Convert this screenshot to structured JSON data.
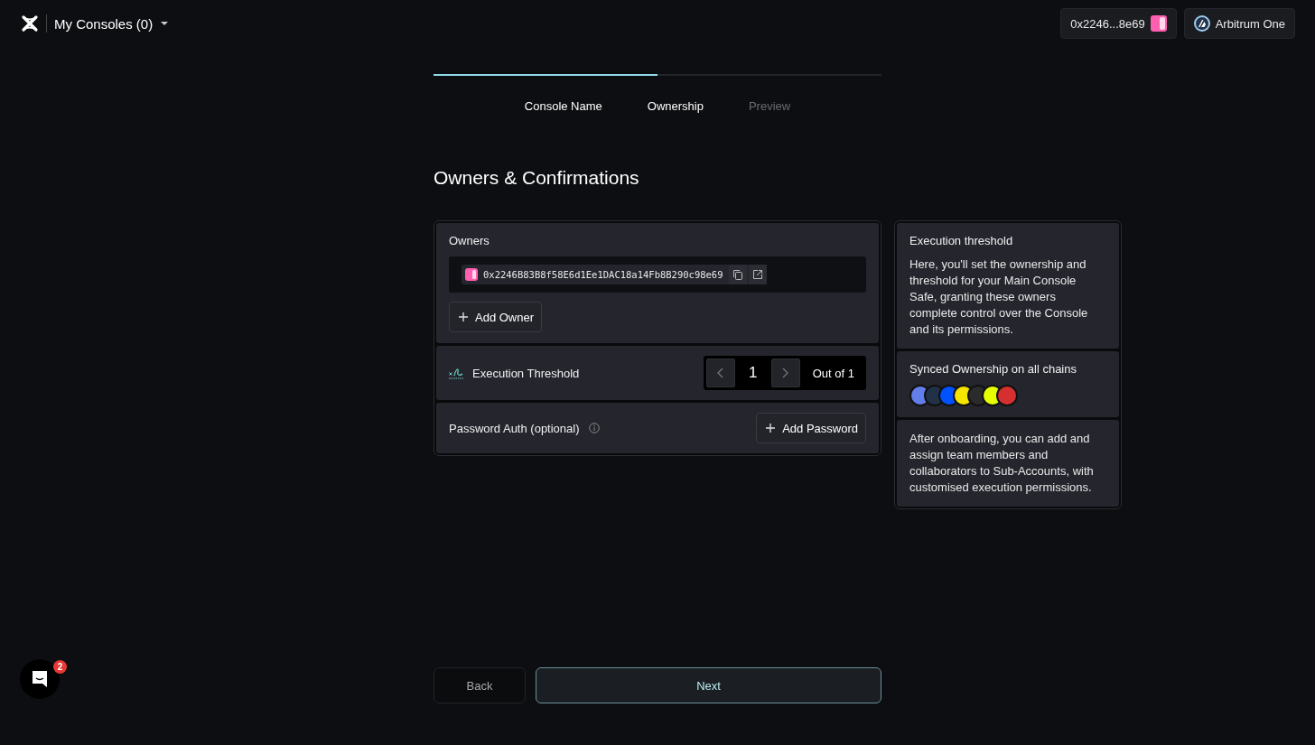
{
  "header": {
    "console_menu": "My Consoles (0)",
    "wallet": "0x2246...8e69",
    "network": "Arbitrum One"
  },
  "progress": {
    "level": 0.5
  },
  "steps": [
    {
      "label": "Console Name",
      "disabled": false
    },
    {
      "label": "Ownership",
      "disabled": false
    },
    {
      "label": "Preview",
      "disabled": true
    }
  ],
  "title": "Owners & Confirmations",
  "owners": {
    "label": "Owners",
    "addresses": [
      "0x2246B83B8f58E6d1Ee1DAC18a14Fb8B290c98e69"
    ],
    "add_button": "Add Owner"
  },
  "threshold": {
    "label": "Execution Threshold",
    "value": "1",
    "total": "Out of 1"
  },
  "password": {
    "label": "Password Auth (optional)",
    "button": "Add Password"
  },
  "info": {
    "title": "Execution threshold",
    "text": "Here, you'll set the ownership and threshold for your Main Console Safe, granting these owners complete control over the Console and its permissions.",
    "sync_title": "Synced Ownership on all chains",
    "chains": [
      {
        "color": "#627eea"
      },
      {
        "color": "#213147"
      },
      {
        "color": "#0052ff"
      },
      {
        "color": "#f5e400"
      },
      {
        "color": "#2b2b2b"
      },
      {
        "color": "#e5ff00"
      },
      {
        "color": "#d62f2f"
      }
    ],
    "footer": "After onboarding, you can add and assign team members and collaborators to Sub-Accounts, with customised execution permissions."
  },
  "buttons": {
    "back": "Back",
    "next": "Next"
  },
  "chat": {
    "badge": "2"
  }
}
